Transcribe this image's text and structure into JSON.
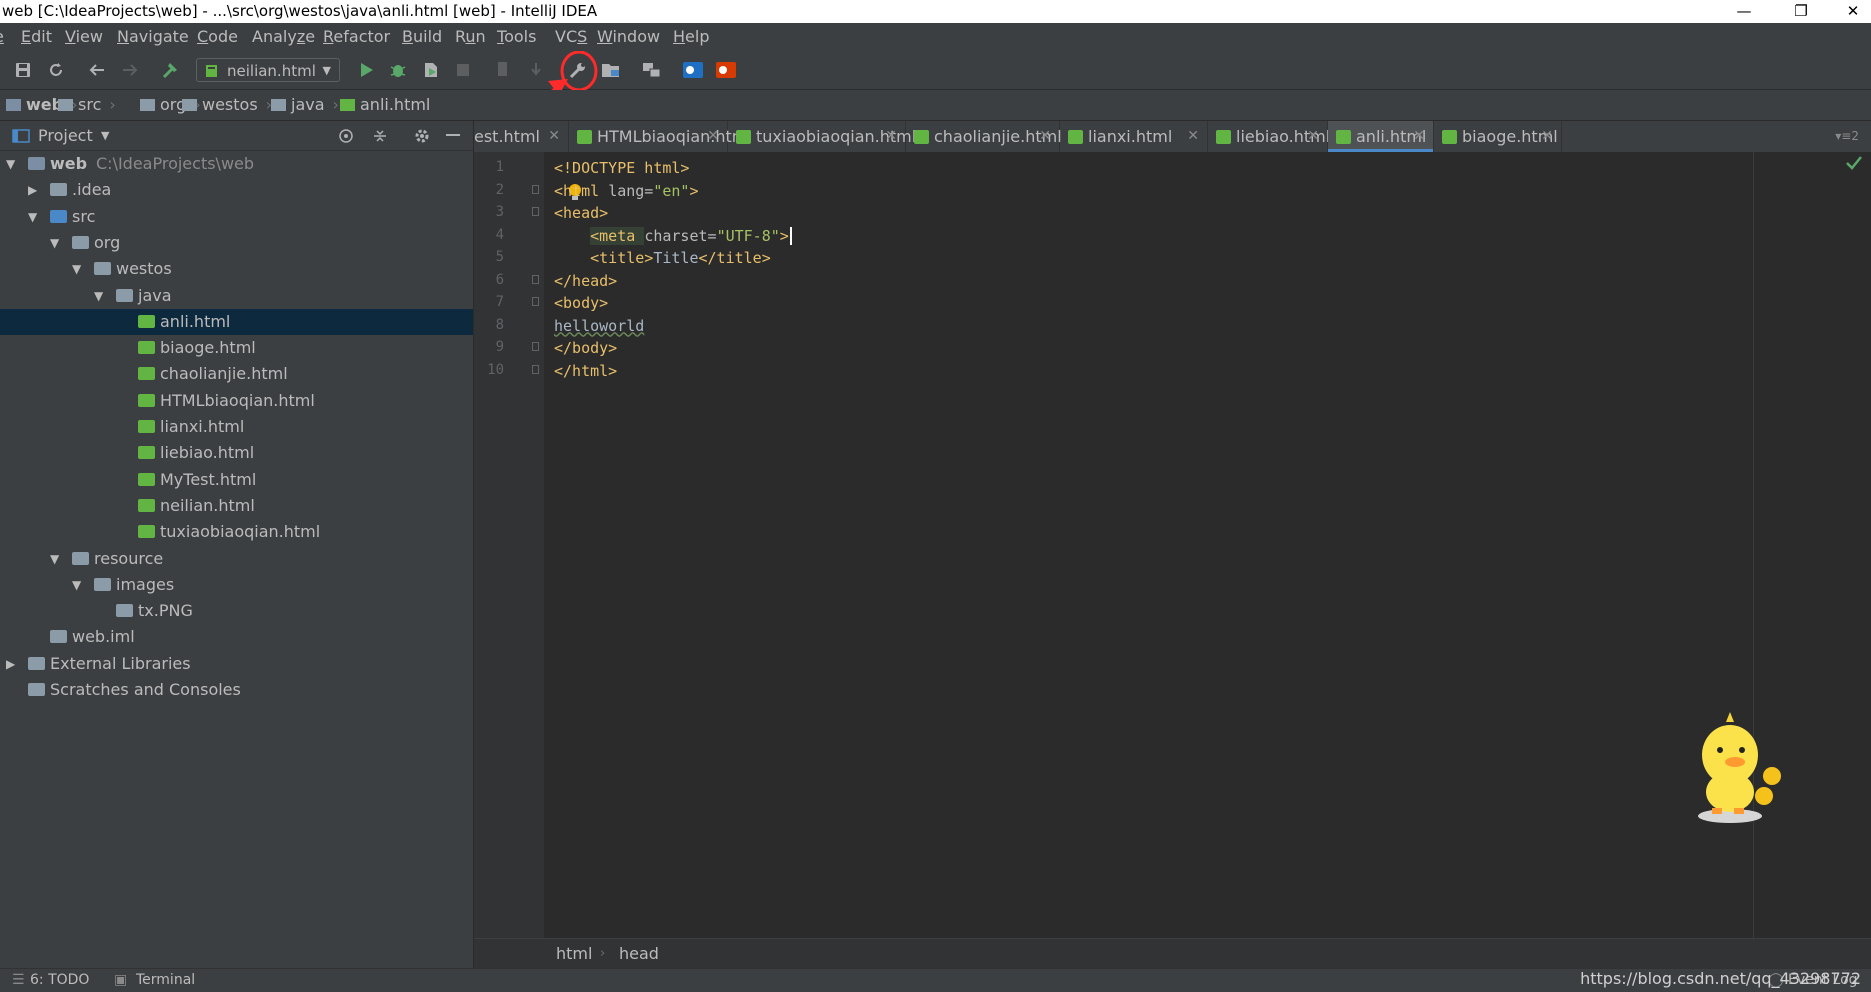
{
  "window": {
    "title": "web [C:\\IdeaProjects\\web] - ...\\src\\org\\westos\\java\\anli.html [web] - IntelliJ IDEA",
    "controls": {
      "minimize": "—",
      "restore": "❐",
      "close": "✕"
    }
  },
  "menu": [
    {
      "pre": "",
      "mn": "e",
      "post": ""
    },
    {
      "pre": "",
      "mn": "E",
      "post": "dit"
    },
    {
      "pre": "",
      "mn": "V",
      "post": "iew"
    },
    {
      "pre": "",
      "mn": "N",
      "post": "avigate"
    },
    {
      "pre": "",
      "mn": "C",
      "post": "ode"
    },
    {
      "pre": "Analy",
      "mn": "z",
      "post": "e"
    },
    {
      "pre": "",
      "mn": "R",
      "post": "efactor"
    },
    {
      "pre": "",
      "mn": "B",
      "post": "uild"
    },
    {
      "pre": "R",
      "mn": "u",
      "post": "n"
    },
    {
      "pre": "",
      "mn": "T",
      "post": "ools"
    },
    {
      "pre": "VC",
      "mn": "S",
      "post": ""
    },
    {
      "pre": "",
      "mn": "W",
      "post": "indow"
    },
    {
      "pre": "",
      "mn": "H",
      "post": "elp"
    }
  ],
  "toolbar": {
    "run_config": "neilian.html",
    "icons": [
      "save-icon",
      "sync-icon",
      "back-icon",
      "forward-icon",
      "build-hammer-icon",
      "run-icon",
      "debug-icon",
      "coverage-icon",
      "stop-icon",
      "vcs-update-icon",
      "vcs-commit-icon",
      "settings-wrench-icon",
      "project-structure-icon",
      "sdk-icon",
      "outlook-icon",
      "office-icon"
    ]
  },
  "navbar": {
    "crumbs": [
      "web",
      "src",
      "org",
      "westos",
      "java",
      "anli.html"
    ]
  },
  "project_panel": {
    "title": "Project",
    "tree": [
      {
        "label": "web",
        "path": "C:\\IdeaProjects\\web",
        "depth": 0,
        "expanded": true,
        "kind": "module",
        "bold": true
      },
      {
        "label": ".idea",
        "depth": 1,
        "expanded": false,
        "kind": "folder"
      },
      {
        "label": "src",
        "depth": 1,
        "expanded": true,
        "kind": "source-folder"
      },
      {
        "label": "org",
        "depth": 2,
        "expanded": true,
        "kind": "package"
      },
      {
        "label": "westos",
        "depth": 3,
        "expanded": true,
        "kind": "package"
      },
      {
        "label": "java",
        "depth": 4,
        "expanded": true,
        "kind": "package"
      },
      {
        "label": "anli.html",
        "depth": 5,
        "kind": "html",
        "selected": true
      },
      {
        "label": "biaoge.html",
        "depth": 5,
        "kind": "html"
      },
      {
        "label": "chaolianjie.html",
        "depth": 5,
        "kind": "html"
      },
      {
        "label": "HTMLbiaoqian.html",
        "depth": 5,
        "kind": "html"
      },
      {
        "label": "lianxi.html",
        "depth": 5,
        "kind": "html"
      },
      {
        "label": "liebiao.html",
        "depth": 5,
        "kind": "html"
      },
      {
        "label": "MyTest.html",
        "depth": 5,
        "kind": "html"
      },
      {
        "label": "neilian.html",
        "depth": 5,
        "kind": "html"
      },
      {
        "label": "tuxiaobiaoqian.html",
        "depth": 5,
        "kind": "html"
      },
      {
        "label": "resource",
        "depth": 2,
        "expanded": true,
        "kind": "package"
      },
      {
        "label": "images",
        "depth": 3,
        "expanded": true,
        "kind": "package"
      },
      {
        "label": "tx.PNG",
        "depth": 4,
        "kind": "image"
      },
      {
        "label": "web.iml",
        "depth": 1,
        "kind": "iml"
      },
      {
        "label": "External Libraries",
        "depth": 0,
        "expanded": false,
        "kind": "library"
      },
      {
        "label": "Scratches and Consoles",
        "depth": 0,
        "kind": "scratch"
      }
    ]
  },
  "tabs": [
    {
      "label": "est.html"
    },
    {
      "label": "HTMLbiaoqian.html"
    },
    {
      "label": "tuxiaobiaoqian.html"
    },
    {
      "label": "chaolianjie.html"
    },
    {
      "label": "lianxi.html"
    },
    {
      "label": "liebiao.html"
    },
    {
      "label": "anli.html",
      "active": true
    },
    {
      "label": "biaoge.html"
    }
  ],
  "tabs_overflow": "2",
  "editor": {
    "lines": [
      [
        [
          "tag",
          "<!DOCTYPE html>"
        ]
      ],
      [
        [
          "tag",
          "<html "
        ],
        [
          "attr",
          "lang="
        ],
        [
          "str",
          "\"en\""
        ],
        [
          "tag",
          ">"
        ]
      ],
      [
        [
          "tag",
          "<head>"
        ]
      ],
      [
        [
          "text",
          "    "
        ],
        [
          "tag",
          "<meta "
        ],
        [
          "attr",
          "charset="
        ],
        [
          "str",
          "\"UTF-8\""
        ],
        [
          "tag",
          ">"
        ]
      ],
      [
        [
          "text",
          "    "
        ],
        [
          "tag",
          "<title>"
        ],
        [
          "text",
          "Title"
        ],
        [
          "tag",
          "</title>"
        ]
      ],
      [
        [
          "tag",
          "</head>"
        ]
      ],
      [
        [
          "tag",
          "<body>"
        ]
      ],
      [
        [
          "text",
          "helloworld"
        ]
      ],
      [
        [
          "tag",
          "</body>"
        ]
      ],
      [
        [
          "tag",
          "</html>"
        ]
      ]
    ]
  },
  "editor_breadcrumbs": [
    "html",
    "head"
  ],
  "bottom_tools": [
    {
      "label": "6: TODO"
    },
    {
      "label": "Terminal"
    }
  ],
  "event_log": "Event Log",
  "watermark": "https://blog.csdn.net/qq_43298772",
  "colors": {
    "annotation": "#ff2a2a",
    "selection": "#0d293e",
    "active_tab_underline": "#4a88c7"
  }
}
